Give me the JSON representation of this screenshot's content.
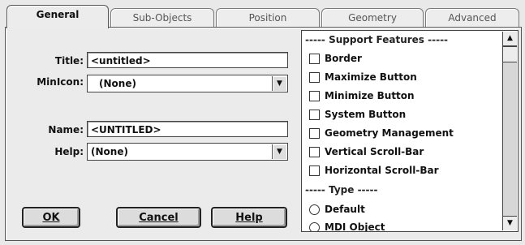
{
  "tabs": [
    {
      "label": "General",
      "active": true
    },
    {
      "label": "Sub-Objects",
      "active": false
    },
    {
      "label": "Position",
      "active": false
    },
    {
      "label": "Geometry",
      "active": false
    },
    {
      "label": "Advanced",
      "active": false
    }
  ],
  "form": {
    "title_label": "Title:",
    "title_value": "<untitled>",
    "minicon_label": "MinIcon:",
    "minicon_value": "(None)",
    "name_label": "Name:",
    "name_value": "<UNTITLED>",
    "help_label": "Help:",
    "help_value": "(None)"
  },
  "buttons": {
    "ok": "OK",
    "cancel": "Cancel",
    "help": "Help"
  },
  "list": {
    "support_header": "----- Support Features -----",
    "support_items": [
      {
        "label": "Border",
        "checked": false
      },
      {
        "label": "Maximize Button",
        "checked": false
      },
      {
        "label": "Minimize Button",
        "checked": false
      },
      {
        "label": "System Button",
        "checked": false
      },
      {
        "label": "Geometry Management",
        "checked": false
      },
      {
        "label": "Vertical Scroll-Bar",
        "checked": false
      },
      {
        "label": "Horizontal Scroll-Bar",
        "checked": false
      }
    ],
    "type_header": "----- Type -----",
    "type_items": [
      {
        "label": "Default",
        "selected": false
      },
      {
        "label": "MDI Object",
        "selected": false
      }
    ]
  },
  "icons": {
    "dropdown": "dropdown-arrow-icon",
    "scroll_up": "scroll-up-icon",
    "scroll_down": "scroll-down-icon"
  },
  "colors": {
    "background": "#e9e9e9",
    "text": "#111111"
  }
}
